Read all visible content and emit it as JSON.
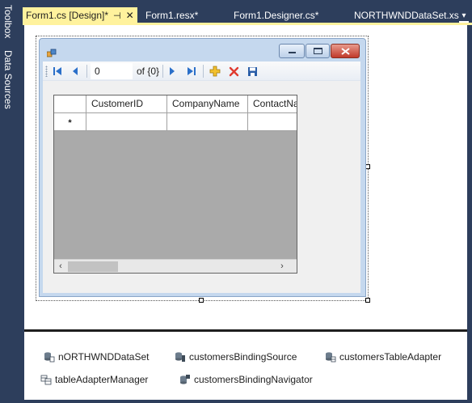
{
  "side_tabs": [
    "Toolbox",
    "Data Sources"
  ],
  "tabs": [
    {
      "label": "Form1.cs [Design]*",
      "active": true
    },
    {
      "label": "Form1.resx*",
      "active": false
    },
    {
      "label": "Form1.Designer.cs*",
      "active": false
    },
    {
      "label": "NORTHWNDDataSet.xs",
      "active": false
    }
  ],
  "icons": {
    "tab_pin": "⊣",
    "tab_close": "✕",
    "overflow": "▾"
  },
  "form": {
    "navigator": {
      "position_value": "0",
      "count_label": "of {0}"
    },
    "grid": {
      "columns": [
        "CustomerID",
        "CompanyName",
        "ContactNa"
      ],
      "new_row_marker": "*",
      "scroll_left": "‹",
      "scroll_right": "›"
    }
  },
  "tray_components": [
    {
      "label": "nORTHWNDDataSet",
      "icon": "dataset-icon"
    },
    {
      "label": "customersBindingSource",
      "icon": "binding-source-icon"
    },
    {
      "label": "customersTableAdapter",
      "icon": "table-adapter-icon"
    },
    {
      "label": "tableAdapterManager",
      "icon": "adapter-manager-icon"
    },
    {
      "label": "customersBindingNavigator",
      "icon": "binding-navigator-icon"
    }
  ],
  "colors": {
    "accent_tab": "#fff29d",
    "ide_background": "#2d3e5c",
    "grid_background": "#aaaaaa"
  }
}
